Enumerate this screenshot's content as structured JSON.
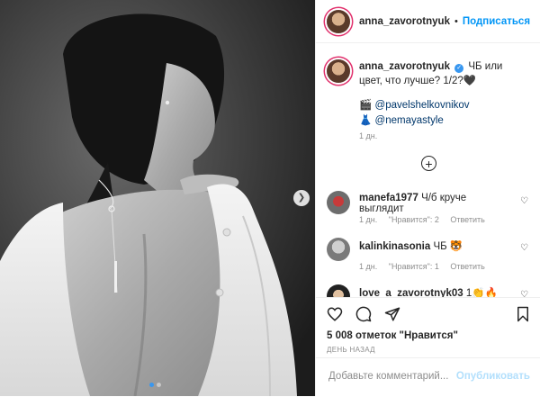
{
  "post": {
    "username": "anna_zavorotnyuk",
    "separator": "•",
    "follow_label": "Подписаться",
    "caption": {
      "author": "anna_zavorotnyuk",
      "verified_icon": "verified-badge-icon",
      "text": "ЧБ или цвет, что лучше? 1/2?🖤",
      "mentions": [
        {
          "emoji": "🎬",
          "handle": "@pavelshelkovnikov"
        },
        {
          "emoji": "👗",
          "handle": "@nemayastyle"
        }
      ],
      "time": "1 дн."
    },
    "load_more_icon": "plus-circle-icon"
  },
  "comments": [
    {
      "username": "manefa1977",
      "text": "Ч/б круче выглядит",
      "time": "1 дн.",
      "likes": "\"Нравится\": 2",
      "reply": "Ответить"
    },
    {
      "username": "kalinkinasonia",
      "text": "ЧБ 🐯",
      "time": "1 дн.",
      "likes": "\"Нравится\": 1",
      "reply": "Ответить"
    },
    {
      "username": "love_a_zavorotnyk03",
      "text": "1👏🔥😍"
    }
  ],
  "actions": {
    "icons": [
      "heart-icon",
      "comment-icon",
      "share-icon",
      "bookmark-icon"
    ],
    "likes": "5 008 отметок \"Нравится\"",
    "date": "ДЕНЬ НАЗАД",
    "comment_placeholder": "Добавьте комментарий...",
    "publish_label": "Опубликовать"
  },
  "carousel": {
    "slide": 1,
    "slides": 2,
    "next_icon": "chevron-right-icon"
  },
  "colors": {
    "accent": "#0095f6",
    "link": "#00376b",
    "muted": "#8e8e8e",
    "disabled_publish": "#b2dffc"
  }
}
